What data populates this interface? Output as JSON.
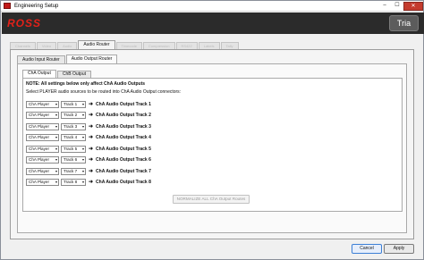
{
  "window": {
    "title": "Engineering Setup",
    "controls": [
      "–",
      "☐",
      "✕"
    ]
  },
  "banner": {
    "brand": "ROSS",
    "product": "Tria"
  },
  "tabs": [
    "Channels",
    "Video",
    "Audio",
    "Audio Router",
    "Timecode",
    "Compression",
    "RS422",
    "Labels",
    "Tally"
  ],
  "active_tab": "Audio Router",
  "subtabs": [
    "Audio Input Router",
    "Audio Output Router"
  ],
  "active_subtab": "Audio Output Router",
  "channel_tabs": [
    "ChA Output",
    "ChB Output"
  ],
  "active_channel_tab": "ChA Output",
  "note": "NOTE: All settings below only affect ChA Audio Outputs",
  "instruction": "Select PLAYER audio sources to be routed into ChA Audio Output connectors:",
  "routes": [
    {
      "source": "ChA Player",
      "track": "Track 1",
      "destination": "ChA Audio Output Track 1"
    },
    {
      "source": "ChA Player",
      "track": "Track 2",
      "destination": "ChA Audio Output Track 2"
    },
    {
      "source": "ChA Player",
      "track": "Track 3",
      "destination": "ChA Audio Output Track 3"
    },
    {
      "source": "ChA Player",
      "track": "Track 4",
      "destination": "ChA Audio Output Track 4"
    },
    {
      "source": "ChA Player",
      "track": "Track 5",
      "destination": "ChA Audio Output Track 5"
    },
    {
      "source": "ChA Player",
      "track": "Track 6",
      "destination": "ChA Audio Output Track 6"
    },
    {
      "source": "ChA Player",
      "track": "Track 7",
      "destination": "ChA Audio Output Track 7"
    },
    {
      "source": "ChA Player",
      "track": "Track 8",
      "destination": "ChA Audio Output Track 8"
    }
  ],
  "normalize_label": "NORMALIZE ALL ChA Output Routes",
  "footer": {
    "cancel": "Cancel",
    "apply": "Apply"
  }
}
